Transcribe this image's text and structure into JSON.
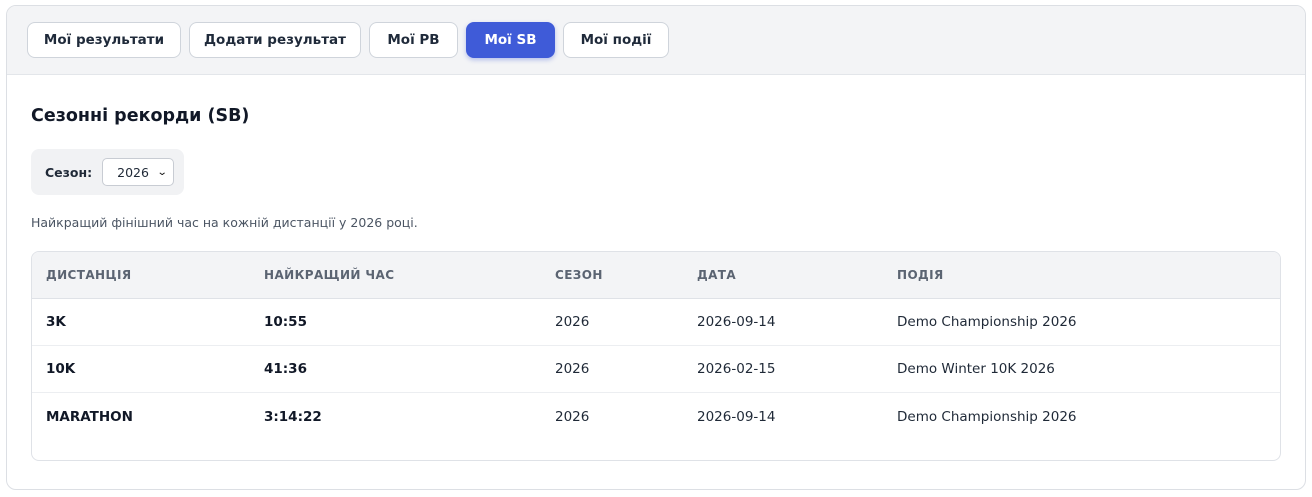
{
  "tabs": [
    {
      "label": "Мої результати",
      "active": false
    },
    {
      "label": "Додати результат",
      "active": false
    },
    {
      "label": "Мої PB",
      "active": false
    },
    {
      "label": "Мої SB",
      "active": true
    },
    {
      "label": "Мої події",
      "active": false
    }
  ],
  "page": {
    "title": "Сезонні рекорди (SB)",
    "season_label": "Сезон:",
    "season_value": "2026",
    "description": "Найкращий фінішний час на кожній дистанції у 2026 році."
  },
  "table": {
    "headers": [
      "ДИСТАНЦІЯ",
      "НАЙКРАЩИЙ ЧАС",
      "СЕЗОН",
      "ДАТА",
      "ПОДІЯ"
    ],
    "rows": [
      {
        "distance": "3K",
        "best_time": "10:55",
        "season": "2026",
        "date": "2026-09-14",
        "event": "Demo Championship 2026"
      },
      {
        "distance": "10K",
        "best_time": "41:36",
        "season": "2026",
        "date": "2026-02-15",
        "event": "Demo Winter 10K 2026"
      },
      {
        "distance": "MARATHON",
        "best_time": "3:14:22",
        "season": "2026",
        "date": "2026-09-14",
        "event": "Demo Championship 2026"
      }
    ]
  },
  "colors": {
    "accent": "#3f5bd8",
    "tabbar_bg": "#f3f4f6"
  }
}
